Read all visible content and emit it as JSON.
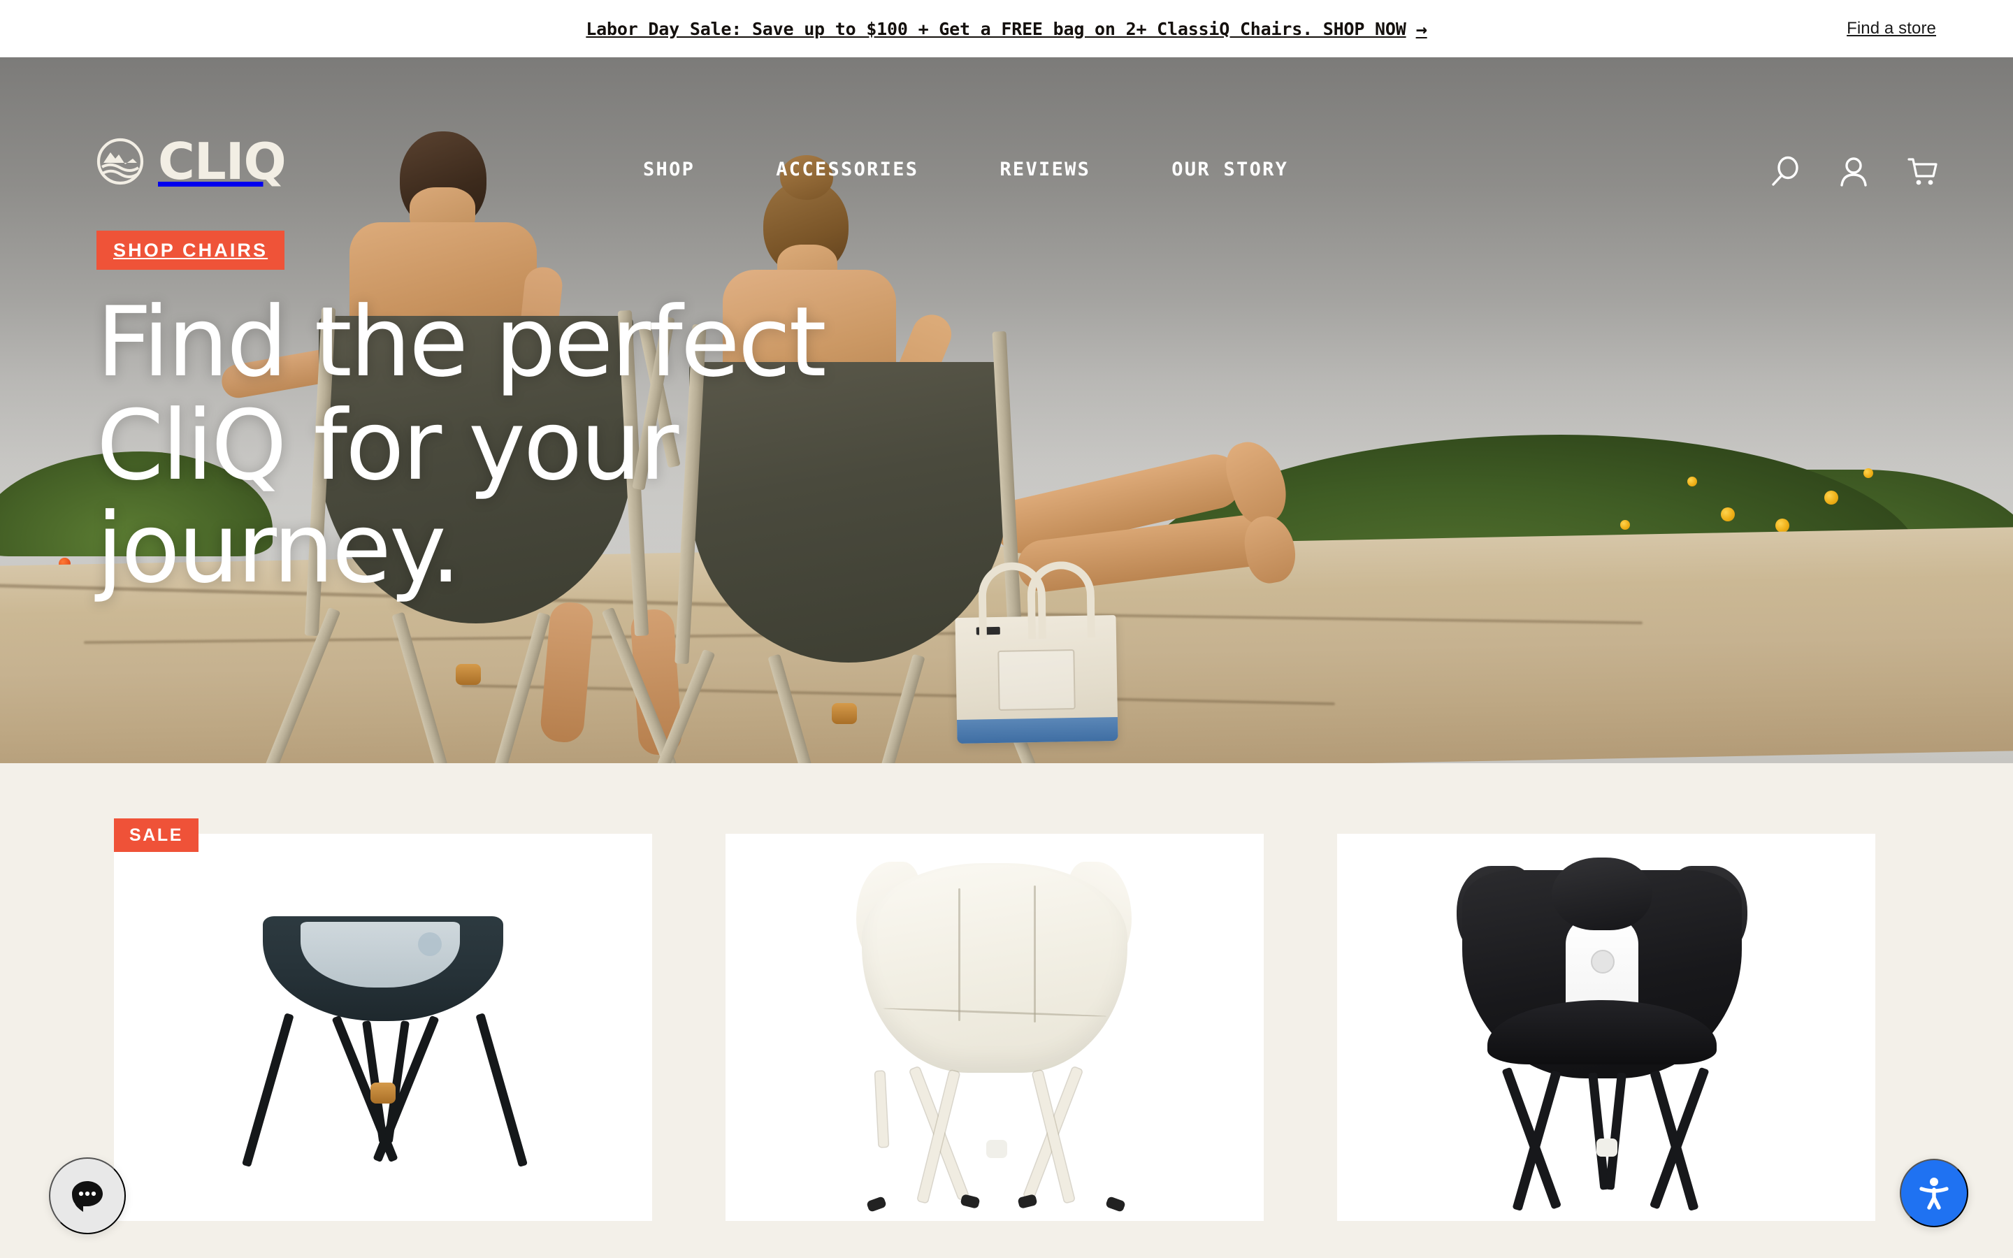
{
  "announcement": {
    "text": "Labor Day Sale: Save up to $100 + Get a FREE bag on 2+ ClassiQ Chairs. SHOP NOW",
    "arrow": "→",
    "find_store": "Find a store"
  },
  "header": {
    "logo_text": "CLIQ",
    "logo_icon": "mountain-wave-circle-icon",
    "nav": [
      {
        "label": "SHOP"
      },
      {
        "label": "ACCESSORIES"
      },
      {
        "label": "REVIEWS"
      },
      {
        "label": "OUR STORY"
      }
    ],
    "icons": [
      {
        "name": "search-icon"
      },
      {
        "name": "account-icon"
      },
      {
        "name": "cart-icon"
      }
    ]
  },
  "hero": {
    "eyebrow": "SHOP CHAIRS",
    "headline": "Find the perfect CliQ for your journey.",
    "accent_color": "#EF5338"
  },
  "products": [
    {
      "badge": "SALE",
      "image": "dark-teal-folding-chair"
    },
    {
      "badge": "",
      "image": "cream-butterfly-folding-chair"
    },
    {
      "badge": "",
      "image": "black-white-panel-folding-chair"
    }
  ],
  "widgets": {
    "chat": {
      "name": "gorgias-chat-button",
      "glyph": "speech-bubble-ellipsis"
    },
    "accessibility": {
      "name": "accessibility-button",
      "glyph": "person-arms-out",
      "color": "#1F72F2"
    }
  },
  "theme": {
    "page_background": "#F3F0E9",
    "accent": "#EF5338",
    "text": "#14100D"
  }
}
